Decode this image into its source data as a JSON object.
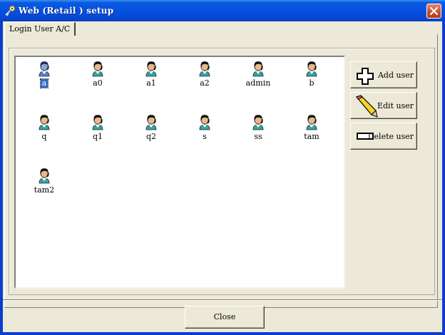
{
  "window": {
    "title": "Web (Retail ) setup"
  },
  "tabs": [
    {
      "label": "Login User A/C"
    }
  ],
  "users": [
    {
      "name": "a",
      "selected": true
    },
    {
      "name": "a0"
    },
    {
      "name": "a1"
    },
    {
      "name": "a2"
    },
    {
      "name": "admin"
    },
    {
      "name": "b"
    },
    {
      "name": "q"
    },
    {
      "name": "q1"
    },
    {
      "name": "q2"
    },
    {
      "name": "s"
    },
    {
      "name": "ss"
    },
    {
      "name": "tam"
    },
    {
      "name": "tam2"
    }
  ],
  "actions": {
    "add_label": "Add user",
    "edit_label": "Edit user",
    "delete_label": "Delete user"
  },
  "footer": {
    "close_label": "Close"
  },
  "icons": {
    "title": "key-icon",
    "user": "user-icon",
    "add": "plus-icon",
    "edit": "pencil-icon",
    "delete": "minus-icon"
  }
}
